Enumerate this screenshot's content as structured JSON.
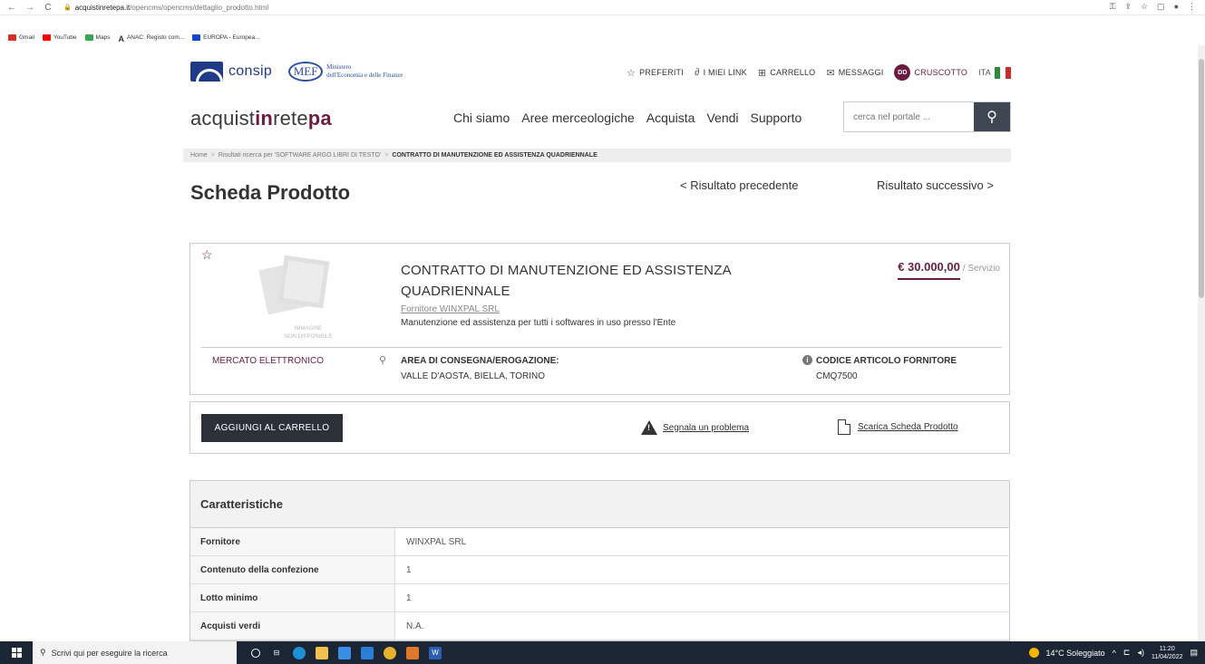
{
  "browser": {
    "url_host": "acquistinretepa.it",
    "url_path": "/opencms/opencms/dettaglio_prodotto.html",
    "bookmarks": [
      "Gmail",
      "YouTube",
      "Maps",
      "ANAC: Registo com...",
      "EUROPA - Europea..."
    ]
  },
  "header": {
    "consip": "consip",
    "mef": "MEF",
    "mef_line1": "Ministero",
    "mef_line2": "dell'Economia e delle Finanze",
    "util": {
      "preferiti": "PREFERITI",
      "link": "I MIEI LINK",
      "carrello": "CARRELLO",
      "messaggi": "MESSAGGI",
      "avatar": "DD",
      "cruscotto": "CRUSCOTTO",
      "lang": "ITA"
    }
  },
  "nav": {
    "brand_parts": [
      "acquist",
      "in",
      "rete",
      "pa"
    ],
    "menu": [
      "Chi siamo",
      "Aree merceologiche",
      "Acquista",
      "Vendi",
      "Supporto"
    ],
    "search_placeholder": "cerca nel portale ..."
  },
  "breadcrumb": {
    "home": "Home",
    "results": "Risultati ricerca per 'SOFTWARE ARGO LIBRI DI TESTO'",
    "current": "CONTRATTO DI MANUTENZIONE ED ASSISTENZA QUADRIENNALE"
  },
  "page": {
    "title": "Scheda Prodotto",
    "prev": "< Risultato precedente",
    "next": "Risultato successivo >"
  },
  "product": {
    "no_image_line1": "IMMAGINE",
    "no_image_line2": "NON DISPONIBILE",
    "name": "CONTRATTO DI MANUTENZIONE ED ASSISTENZA QUADRIENNALE",
    "supplier": "Fornitore WINXPAL SRL",
    "description": "Manutenzione ed assistenza per tutti i softwares in uso presso l'Ente",
    "price": "€ 30.000,00",
    "price_unit": "/ Servizio",
    "market": "MERCATO ELETTRONICO",
    "area_label": "AREA DI CONSEGNA/EROGAZIONE:",
    "area_value": "VALLE D'AOSTA, BIELLA, TORINO",
    "code_label": "CODICE ARTICOLO FORNITORE",
    "code_value": "CMQ7500"
  },
  "actions": {
    "add_to_cart": "AGGIUNGI AL CARRELLO",
    "report": "Segnala un problema",
    "download": "Scarica Scheda Prodotto"
  },
  "specs": {
    "title": "Caratteristiche",
    "rows": [
      {
        "key": "Fornitore",
        "value": "WINXPAL SRL"
      },
      {
        "key": "Contenuto della confezione",
        "value": "1"
      },
      {
        "key": "Lotto minimo",
        "value": "1"
      },
      {
        "key": "Acquisti verdi",
        "value": "N.A."
      }
    ]
  },
  "taskbar": {
    "search_placeholder": "Scrivi qui per eseguire la ricerca",
    "weather": "14°C Soleggiato",
    "time": "11:20",
    "date": "11/04/2022"
  },
  "colors": {
    "accent": "#6b1d3f",
    "dark_button": "#2c3038",
    "consip_blue": "#1f3b87"
  }
}
